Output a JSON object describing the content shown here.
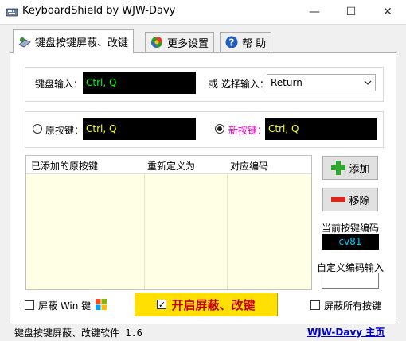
{
  "window": {
    "title": "KeyboardShield by WJW-Davy",
    "controls": [
      "—",
      "☐",
      "✕"
    ]
  },
  "tabs": [
    {
      "label": "键盘按键屏蔽、改键",
      "icon": "keyboard-icon"
    },
    {
      "label": "更多设置",
      "icon": "settings-ball-icon"
    },
    {
      "label": "帮 助",
      "icon": "help-icon"
    }
  ],
  "keyboard_input": {
    "label": "键盘输入：",
    "value": "Ctrl, Q",
    "or_label": "或 选择输入：",
    "select_value": "Return"
  },
  "mapping": {
    "original_label": "原按键：",
    "original_value": "Ctrl, Q",
    "new_label": "新按键：",
    "new_value": "Ctrl, Q"
  },
  "list": {
    "headers": [
      "已添加的原按键",
      "重新定义为",
      "对应编码"
    ]
  },
  "buttons": {
    "add": "添加",
    "remove": "移除",
    "toggle": "开启屏蔽、改键"
  },
  "code": {
    "current_label": "当前按键编码",
    "current_value": "cv81",
    "custom_label": "自定义编码输入",
    "custom_value": ""
  },
  "checkboxes": {
    "block_win": "屏蔽 Win 键",
    "block_all": "屏蔽所有按键"
  },
  "status": {
    "version_text": "键盘按键屏蔽、改键软件 1.6",
    "homepage_link": "WJW-Davy 主页"
  },
  "colors": {
    "green_text": "#00ff00",
    "yellow_text": "#ffff00",
    "new_key_label": "#e000c0",
    "link": "#0000cc",
    "toggle_bg": "#ffe000",
    "code_bg": "#000000",
    "code_text": "#00ccff"
  }
}
